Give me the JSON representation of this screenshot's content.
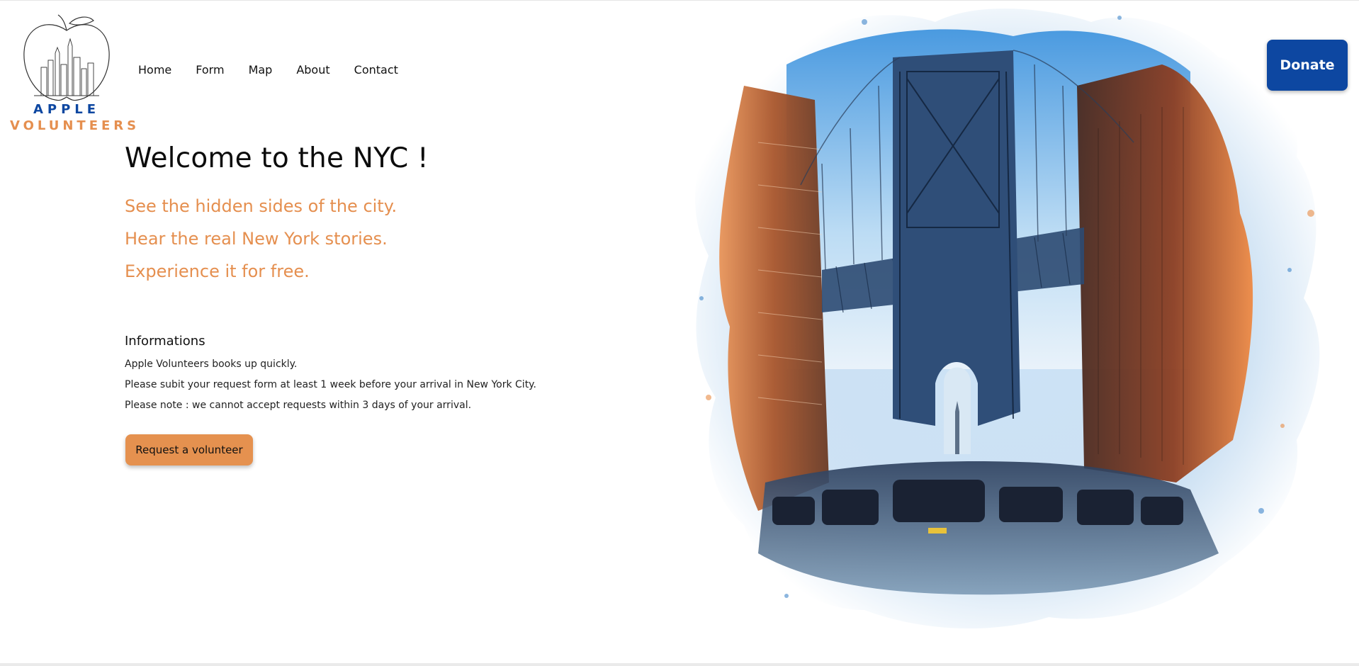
{
  "logo": {
    "line1": "APPLE",
    "line2": "VOLUNTEERS",
    "colors": {
      "blue": "#0d47a1",
      "orange": "#e58f4f"
    }
  },
  "nav": {
    "items": [
      "Home",
      "Form",
      "Map",
      "About",
      "Contact"
    ]
  },
  "donate": {
    "label": "Donate",
    "color": "#0d47a1"
  },
  "hero": {
    "title": "Welcome to the NYC !",
    "taglines": [
      "See the hidden sides of the city.",
      "Hear the real New York stories.",
      "Experience it for free."
    ],
    "tagline_color": "#e58f4f"
  },
  "info": {
    "heading": "Informations",
    "lines": [
      "Apple Volunteers books up quickly.",
      "Please subit your request form at least 1 week before your arrival in New York City.",
      "Please note : we cannot accept requests within 3 days of your arrival."
    ]
  },
  "cta": {
    "label": "Request a volunteer",
    "color": "#e5914f"
  },
  "illustration": {
    "icon": "manhattan-bridge-watercolor-image"
  }
}
